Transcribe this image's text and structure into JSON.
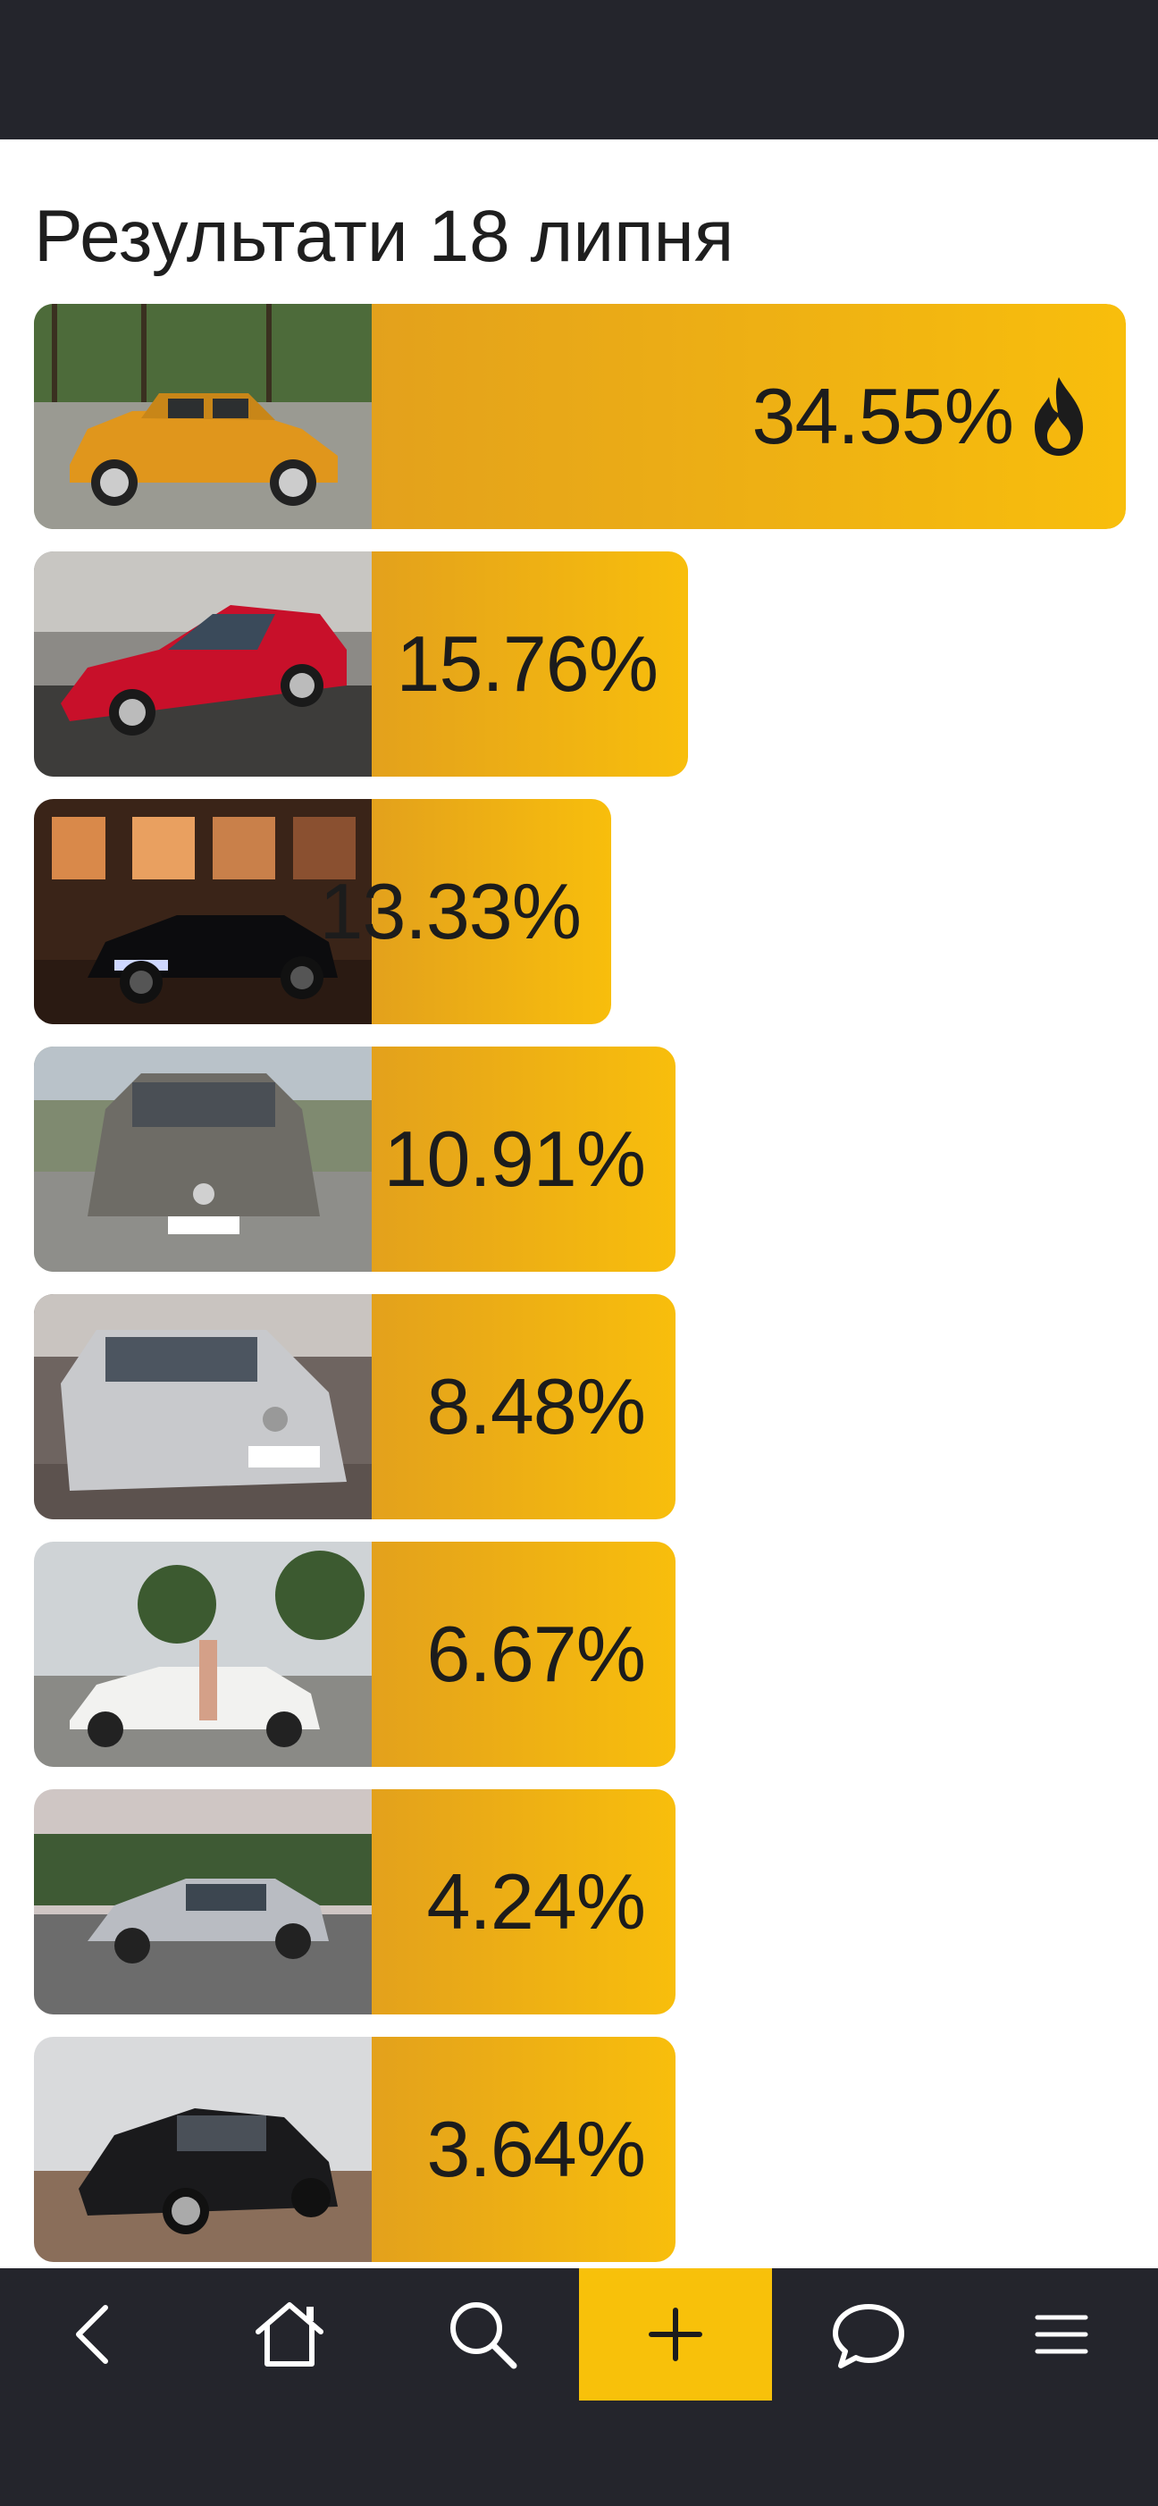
{
  "page": {
    "title": "Результати 18 липня"
  },
  "results": [
    {
      "percent": "34.55%",
      "value": 34.55,
      "top": true,
      "photo": "orange-hatchback-photo"
    },
    {
      "percent": "15.76%",
      "value": 15.76,
      "top": false,
      "photo": "red-coupe-photo"
    },
    {
      "percent": "13.33%",
      "value": 13.33,
      "top": false,
      "photo": "black-sedan-garage-photo"
    },
    {
      "percent": "10.91%",
      "value": 10.91,
      "top": false,
      "photo": "grey-hatchback-graphite-photo"
    },
    {
      "percent": "8.48%",
      "value": 8.48,
      "top": false,
      "photo": "silver-passat-photo"
    },
    {
      "percent": "6.67%",
      "value": 6.67,
      "top": false,
      "photo": "white-polo-photo"
    },
    {
      "percent": "4.24%",
      "value": 4.24,
      "top": false,
      "photo": "silver-audi-sedan-photo"
    },
    {
      "percent": "3.64%",
      "value": 3.64,
      "top": false,
      "photo": "black-mazda-hatchback-photo"
    }
  ],
  "nav": {
    "items": [
      {
        "icon": "back-icon"
      },
      {
        "icon": "home-icon"
      },
      {
        "icon": "search-icon"
      },
      {
        "icon": "plus-icon",
        "active": true
      },
      {
        "icon": "chat-icon"
      },
      {
        "icon": "menu-icon"
      }
    ]
  },
  "colors": {
    "accent": "#f8c10a",
    "bar_start": "#e3a11c",
    "bar_end": "#f8be0c",
    "dark": "#24252c"
  }
}
